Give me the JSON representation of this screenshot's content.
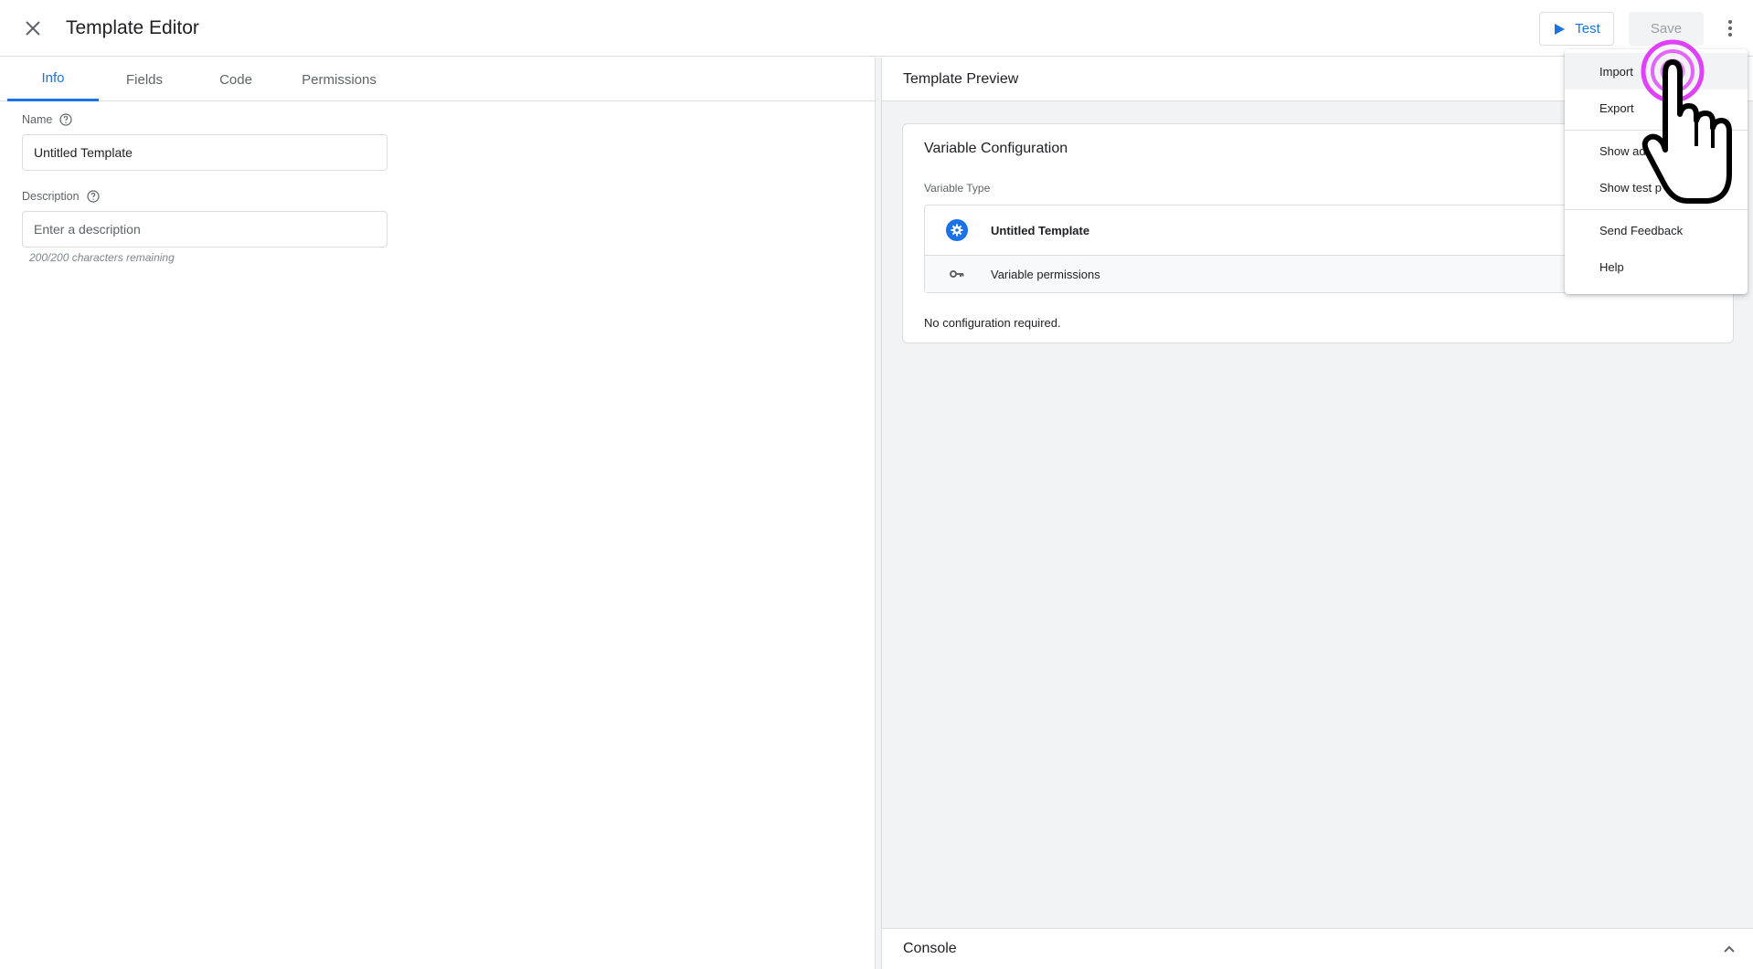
{
  "header": {
    "title": "Template Editor",
    "test_label": "Test",
    "save_label": "Save"
  },
  "tabs": [
    {
      "label": "Info",
      "active": true
    },
    {
      "label": "Fields",
      "active": false
    },
    {
      "label": "Code",
      "active": false
    },
    {
      "label": "Permissions",
      "active": false
    }
  ],
  "info": {
    "name_label": "Name",
    "name_value": "Untitled Template",
    "description_label": "Description",
    "description_placeholder": "Enter a description",
    "char_count": "200/200 characters remaining"
  },
  "preview": {
    "title": "Template Preview",
    "config_title": "Variable Configuration",
    "var_type_label": "Variable Type",
    "var_name": "Untitled Template",
    "var_permissions": "Variable permissions",
    "no_config": "No configuration required.",
    "console_title": "Console"
  },
  "menu": {
    "items": [
      {
        "label": "Import"
      },
      {
        "label": "Export"
      },
      {
        "label": "Show ad"
      },
      {
        "label": "Show test p"
      },
      {
        "label": "Send Feedback"
      },
      {
        "label": "Help"
      }
    ]
  },
  "colors": {
    "accent": "#1a73e8",
    "border": "#dadce0",
    "panel_bg": "#f1f3f4",
    "cursor_highlight": "#e040fb"
  },
  "icons": [
    "close-icon",
    "play-icon",
    "more-vert-icon",
    "help-icon",
    "gear-icon",
    "key-icon",
    "chevron-up-icon",
    "pointer-hand-icon"
  ]
}
